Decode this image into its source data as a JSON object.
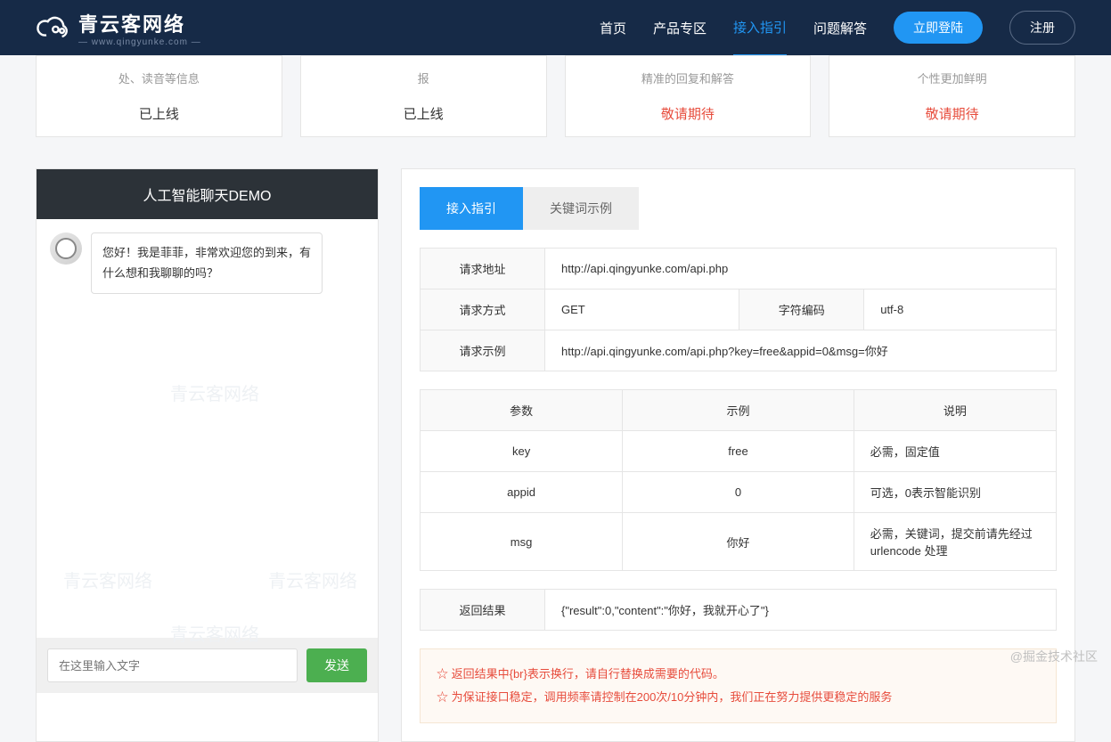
{
  "header": {
    "brand": "青云客网络",
    "brand_sub": "— www.qingyunke.com —",
    "nav": [
      "首页",
      "产品专区",
      "接入指引",
      "问题解答"
    ],
    "login": "立即登陆",
    "register": "注册"
  },
  "cards": [
    {
      "desc": "处、读音等信息",
      "status": "已上线",
      "pending": false
    },
    {
      "desc": "报",
      "status": "已上线",
      "pending": false
    },
    {
      "desc": "精准的回复和解答",
      "status": "敬请期待",
      "pending": true
    },
    {
      "desc": "个性更加鲜明",
      "status": "敬请期待",
      "pending": true
    }
  ],
  "chat": {
    "title": "人工智能聊天DEMO",
    "greeting": "您好！我是菲菲，非常欢迎您的到来，有什么想和我聊聊的吗？",
    "placeholder": "在这里输入文字",
    "send": "发送",
    "watermark": "青云客网络"
  },
  "tabs": {
    "a": "接入指引",
    "b": "关键词示例"
  },
  "reqTable": {
    "url_label": "请求地址",
    "url": "http://api.qingyunke.com/api.php",
    "method_label": "请求方式",
    "method": "GET",
    "enc_label": "字符编码",
    "enc": "utf-8",
    "example_label": "请求示例",
    "example": "http://api.qingyunke.com/api.php?key=free&appid=0&msg=你好"
  },
  "paramTable": {
    "h1": "参数",
    "h2": "示例",
    "h3": "说明",
    "rows": [
      {
        "p": "key",
        "e": "free",
        "d": "必需，固定值"
      },
      {
        "p": "appid",
        "e": "0",
        "d": "可选，0表示智能识别"
      },
      {
        "p": "msg",
        "e": "你好",
        "d": "必需，关键词，提交前请先经过 urlencode 处理"
      }
    ]
  },
  "retTable": {
    "label": "返回结果",
    "value": "{\"result\":0,\"content\":\"你好，我就开心了\"}"
  },
  "notes": [
    "☆ 返回结果中{br}表示换行，请自行替换成需要的代码。",
    "☆ 为保证接口稳定，调用频率请控制在200次/10分钟内，我们正在努力提供更稳定的服务"
  ],
  "corner": "@掘金技术社区"
}
